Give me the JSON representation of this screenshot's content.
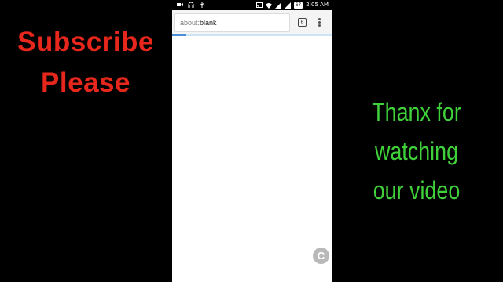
{
  "overlay": {
    "left_line1": "Subscribe",
    "left_line2": "Please",
    "right_line1": "Thanx for watching",
    "right_line2": "our video",
    "left_color": "#e8271c",
    "right_color": "#3fd13a"
  },
  "statusbar": {
    "time": "2:05 AM",
    "battery": "67",
    "left_icons": [
      "video-icon",
      "headphones-icon",
      "usb-icon"
    ],
    "right_icons": [
      "cast-icon",
      "wifi-icon",
      "signal-icon",
      "signal-icon"
    ]
  },
  "browser": {
    "url_scheme": "about:",
    "url_path": "blank",
    "tab_count": "6",
    "load_progress_percent": 9,
    "fab_label": "C"
  }
}
